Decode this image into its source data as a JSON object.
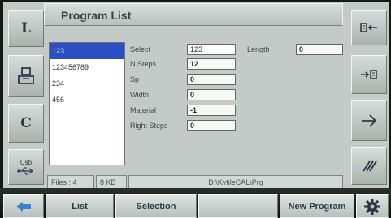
{
  "window": {
    "title": "Program List"
  },
  "left_buttons": [
    {
      "label": "L"
    },
    {
      "label": ""
    },
    {
      "label": "C"
    },
    {
      "label": "Usb"
    }
  ],
  "program_list": [
    "123",
    "123456789",
    "234",
    "456"
  ],
  "fields": {
    "select": {
      "label": "Select",
      "value": "123"
    },
    "n_steps": {
      "label": "N Steps",
      "value": "12"
    },
    "sp": {
      "label": "Sp",
      "value": "0"
    },
    "width": {
      "label": "Width",
      "value": "0"
    },
    "material": {
      "label": "Material",
      "value": "-1"
    },
    "right_steps": {
      "label": "Right Steps",
      "value": "0"
    },
    "length": {
      "label": "Length",
      "value": "0"
    }
  },
  "status": {
    "files": "Files : 4",
    "size": "8 KB",
    "path": "D:\\KvtileCAL\\Prg"
  },
  "bottom_buttons": {
    "list": "List",
    "selection": "Selection",
    "empty": "",
    "new_program": "New Program"
  },
  "colors": {
    "selection": "#2a4fc2",
    "screen": "#c4cac8",
    "accent_blue": "#3a7fd0"
  }
}
